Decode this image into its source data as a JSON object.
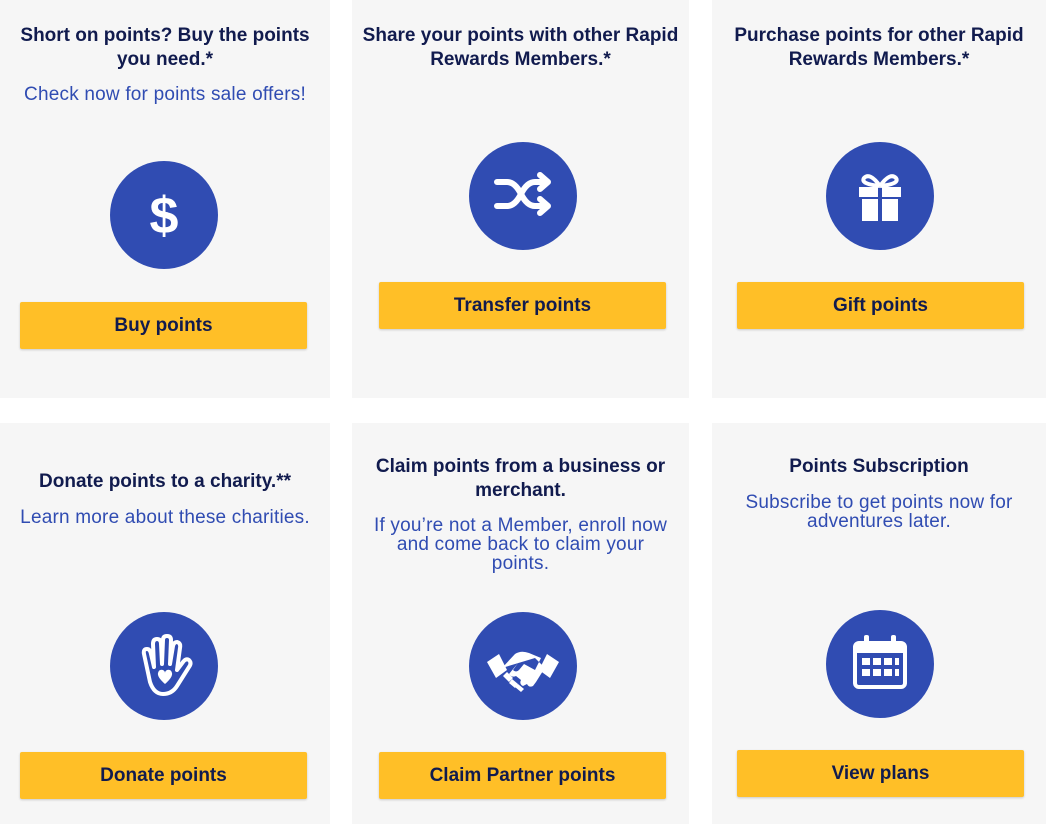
{
  "colors": {
    "card_background": "#f6f6f6",
    "title_text": "#111b4e",
    "description_text": "#304cb2",
    "icon_circle": "#304cb2",
    "button_background": "#ffbf27",
    "button_text": "#111b4e"
  },
  "cards": [
    {
      "title": "Short on points? Buy the points you need.*",
      "description": "Check now for points sale offers!",
      "icon": "dollar-sign-icon",
      "button_label": "Buy points"
    },
    {
      "title": "Share your points with other Rapid Rewards Members.*",
      "description": "",
      "icon": "shuffle-arrows-icon",
      "button_label": "Transfer points"
    },
    {
      "title": "Purchase points for other Rapid Rewards Members.*",
      "description": "",
      "icon": "gift-icon",
      "button_label": "Gift points"
    },
    {
      "title": "Donate points to a charity.**",
      "description": "Learn more about these charities.",
      "icon": "hand-heart-icon",
      "button_label": "Donate points"
    },
    {
      "title": "Claim points from a business or merchant.",
      "description": "If you’re not a Member, enroll now and come back to claim your points.",
      "icon": "handshake-icon",
      "button_label": "Claim Partner points"
    },
    {
      "title": "Points Subscription",
      "description": "Subscribe to get points now for adventures later.",
      "icon": "calendar-icon",
      "button_label": "View plans"
    }
  ]
}
